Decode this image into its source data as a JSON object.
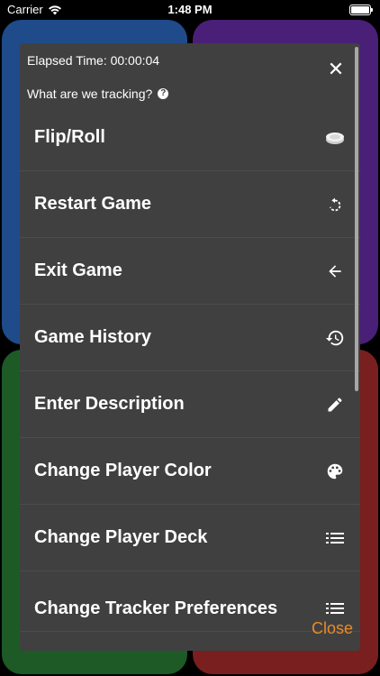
{
  "status_bar": {
    "carrier": "Carrier",
    "time": "1:48 PM"
  },
  "sheet": {
    "elapsed": "Elapsed Time: 00:00:04",
    "tracking_prompt": "What are we tracking?",
    "close_label": "Close",
    "menu": [
      {
        "label": "Flip/Roll",
        "icon": "coin-icon"
      },
      {
        "label": "Restart Game",
        "icon": "restart-icon"
      },
      {
        "label": "Exit Game",
        "icon": "arrow-left-icon"
      },
      {
        "label": "Game History",
        "icon": "history-icon"
      },
      {
        "label": "Enter Description",
        "icon": "pencil-icon"
      },
      {
        "label": "Change Player Color",
        "icon": "palette-icon"
      },
      {
        "label": "Change Player Deck",
        "icon": "list-icon"
      },
      {
        "label": "Change Tracker Preferences",
        "icon": "list-icon"
      }
    ]
  },
  "colors": {
    "sheet_bg": "#404040",
    "accent": "#e88b2a",
    "player_blue": "#1f4b8a",
    "player_purple": "#4a1f78",
    "player_green": "#1d5a26",
    "player_red": "#7a1f1f"
  }
}
